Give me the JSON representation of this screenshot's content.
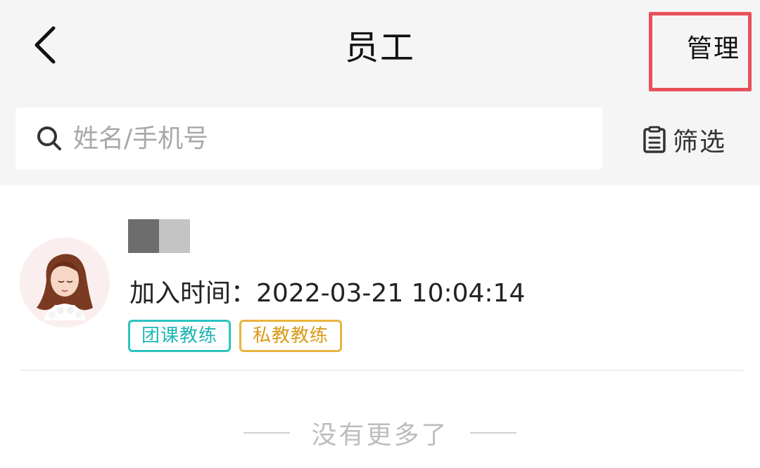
{
  "header": {
    "title": "员工",
    "manage_label": "管理"
  },
  "search": {
    "placeholder": "姓名/手机号",
    "value": ""
  },
  "filter": {
    "label": "筛选"
  },
  "staff_list": [
    {
      "join_label": "加入时间：",
      "join_time": "2022-03-21 10:04:14",
      "tags": [
        "团课教练",
        "私教教练"
      ]
    }
  ],
  "footer": {
    "end_text": "没有更多了"
  },
  "colors": {
    "highlight_border": "#e8505b",
    "tag_group": "#2cc3c3",
    "tag_private": "#e9b43d"
  },
  "icons": {
    "back": "chevron-left-icon",
    "search": "search-icon",
    "filter": "clipboard-list-icon"
  }
}
